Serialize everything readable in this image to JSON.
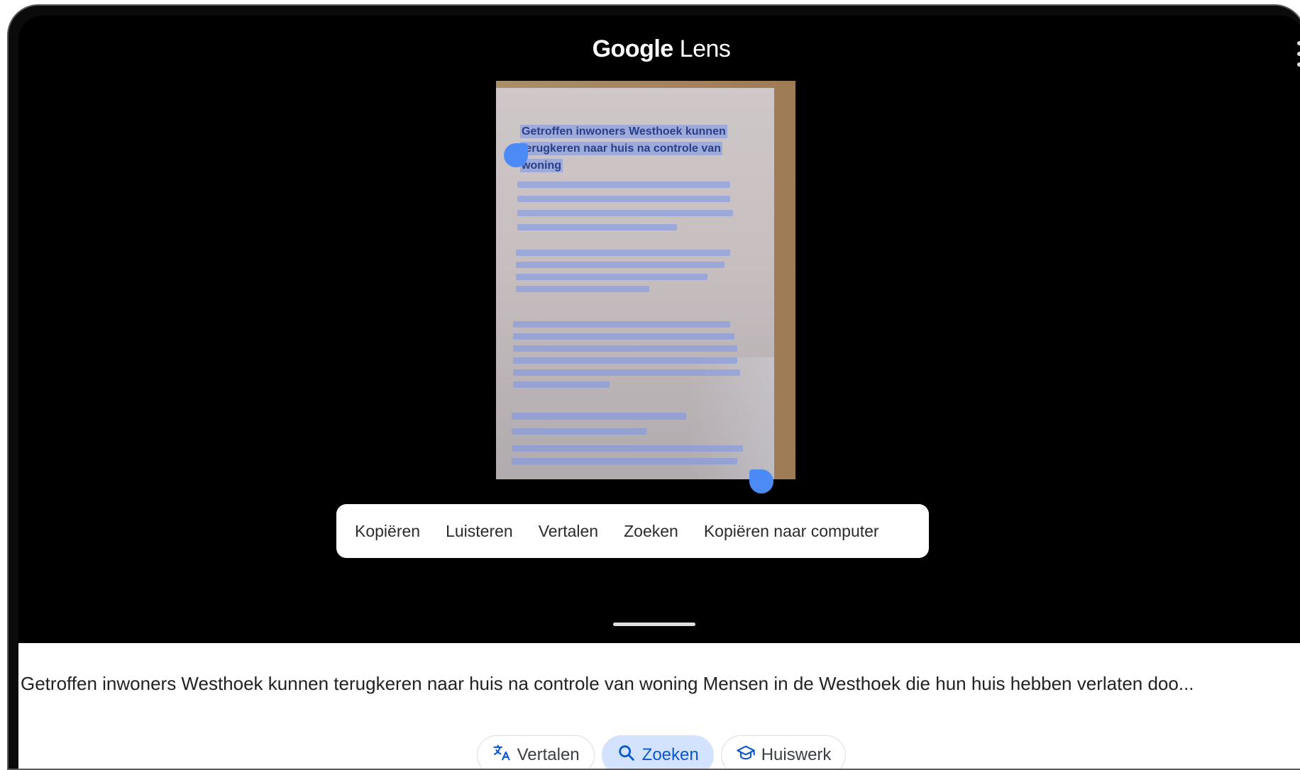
{
  "header": {
    "title_brand": "Google",
    "title_product": "Lens"
  },
  "photo": {
    "heading_lines": [
      "Getroffen inwoners Westhoek kunnen",
      "terugkeren naar huis na controle van",
      "woning"
    ]
  },
  "selection_actions": [
    {
      "label": "Kopiëren"
    },
    {
      "label": "Luisteren"
    },
    {
      "label": "Vertalen"
    },
    {
      "label": "Zoeken"
    },
    {
      "label": "Kopiëren naar computer"
    }
  ],
  "sheet": {
    "extracted_text": "Getroffen inwoners Westhoek kunnen terugkeren naar huis na controle van woning Mensen in de Westhoek die hun huis hebben verlaten doo..."
  },
  "chips": [
    {
      "label": "Vertalen",
      "icon": "translate-icon",
      "active": false
    },
    {
      "label": "Zoeken",
      "icon": "search-icon",
      "active": true
    },
    {
      "label": "Huiswerk",
      "icon": "graduation-cap-icon",
      "active": false
    }
  ],
  "colors": {
    "accent": "#0b57d0",
    "chip_active_bg": "#d3e3fd",
    "selection_handle": "#4c8bf5",
    "highlight": "#7896eb"
  }
}
